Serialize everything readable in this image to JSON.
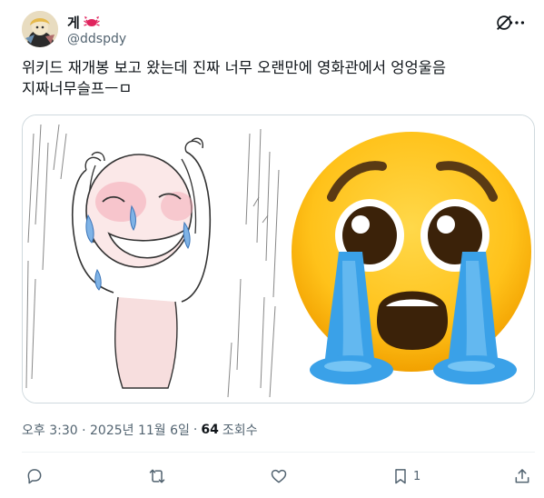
{
  "tweet": {
    "author": {
      "display_name": "게",
      "name_emoji": "crab-icon",
      "handle": "@ddspdy"
    },
    "text": "위키드 재개봉 보고 왔는데 진짜 너무 오랜만에 영화관에서 엉엉울음 지짜너무슬프ㅡㅁ",
    "media": {
      "left": "sketch-crying-figure",
      "right": "loudly-crying-face-emoji"
    },
    "timestamp": "오후 3:30 · 2025년 11월 6일",
    "separator": "·",
    "views_count": "64",
    "views_label": "조회수"
  },
  "actions": {
    "reply": {
      "icon": "reply-icon",
      "count": ""
    },
    "retweet": {
      "icon": "retweet-icon",
      "count": ""
    },
    "like": {
      "icon": "heart-icon",
      "count": ""
    },
    "bookmark": {
      "icon": "bookmark-icon",
      "count": "1"
    },
    "share": {
      "icon": "share-icon",
      "count": ""
    }
  },
  "colors": {
    "text_primary": "#0f1419",
    "text_secondary": "#536471",
    "border": "#cfd9de",
    "crab": "#e0245e"
  }
}
